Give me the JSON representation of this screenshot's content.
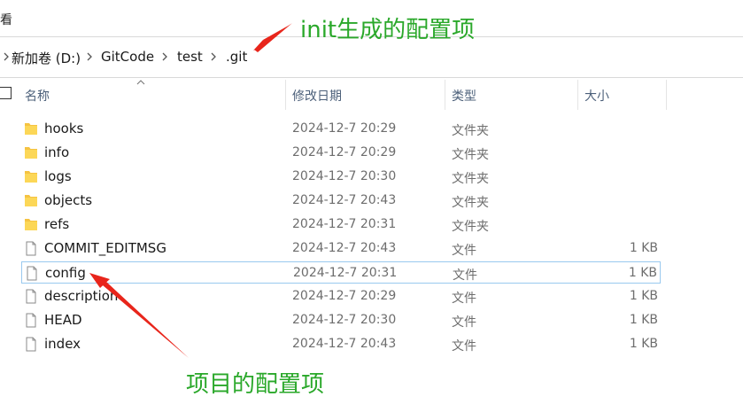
{
  "menu_fragment": "看",
  "breadcrumb": [
    "新加卷 (D:)",
    "GitCode",
    "test",
    ".git"
  ],
  "columns": {
    "name": "名称",
    "modified": "修改日期",
    "type": "类型",
    "size": "大小"
  },
  "files": [
    {
      "name": "hooks",
      "modified": "2024-12-7 20:29",
      "type": "文件夹",
      "size": "",
      "kind": "folder"
    },
    {
      "name": "info",
      "modified": "2024-12-7 20:29",
      "type": "文件夹",
      "size": "",
      "kind": "folder"
    },
    {
      "name": "logs",
      "modified": "2024-12-7 20:30",
      "type": "文件夹",
      "size": "",
      "kind": "folder"
    },
    {
      "name": "objects",
      "modified": "2024-12-7 20:43",
      "type": "文件夹",
      "size": "",
      "kind": "folder"
    },
    {
      "name": "refs",
      "modified": "2024-12-7 20:31",
      "type": "文件夹",
      "size": "",
      "kind": "folder"
    },
    {
      "name": "COMMIT_EDITMSG",
      "modified": "2024-12-7 20:43",
      "type": "文件",
      "size": "1 KB",
      "kind": "file"
    },
    {
      "name": "config",
      "modified": "2024-12-7 20:31",
      "type": "文件",
      "size": "1 KB",
      "kind": "file"
    },
    {
      "name": "description",
      "modified": "2024-12-7 20:29",
      "type": "文件",
      "size": "1 KB",
      "kind": "file"
    },
    {
      "name": "HEAD",
      "modified": "2024-12-7 20:30",
      "type": "文件",
      "size": "1 KB",
      "kind": "file"
    },
    {
      "name": "index",
      "modified": "2024-12-7 20:43",
      "type": "文件",
      "size": "1 KB",
      "kind": "file"
    }
  ],
  "annotations": {
    "init_label": "init生成的配置项",
    "project_label": "项目的配置项"
  },
  "colors": {
    "annotation_text": "#2aa82a",
    "arrow": "#e8251b",
    "selection_border": "#99c9ef",
    "folder_fill": "#f5c342"
  }
}
